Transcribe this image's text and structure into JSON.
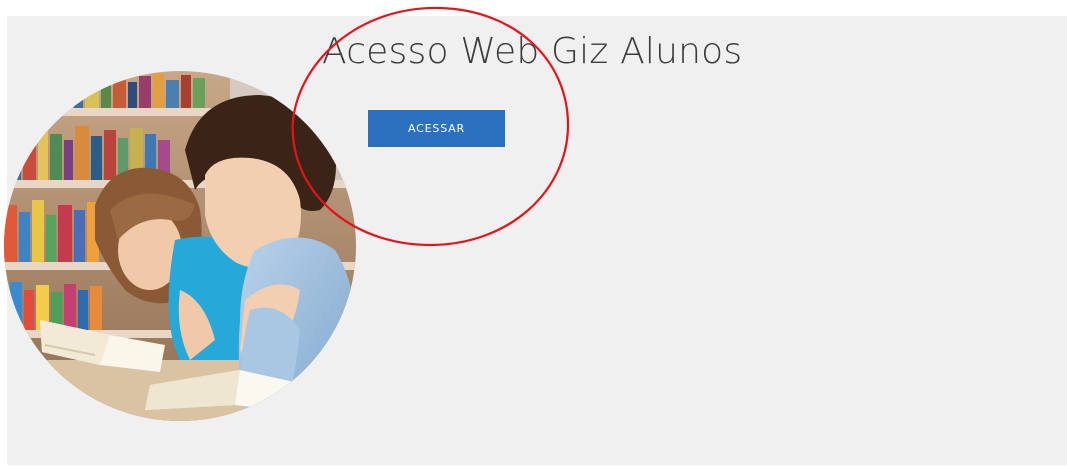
{
  "page": {
    "title": "Acesso Web Giz Alunos",
    "button_label": "ACESSAR"
  },
  "colors": {
    "panel_bg": "#f0f0f0",
    "button_bg": "#2b71bf",
    "annotation_stroke": "#e3141b"
  },
  "image": {
    "description_icon": "students-reading-photo"
  }
}
